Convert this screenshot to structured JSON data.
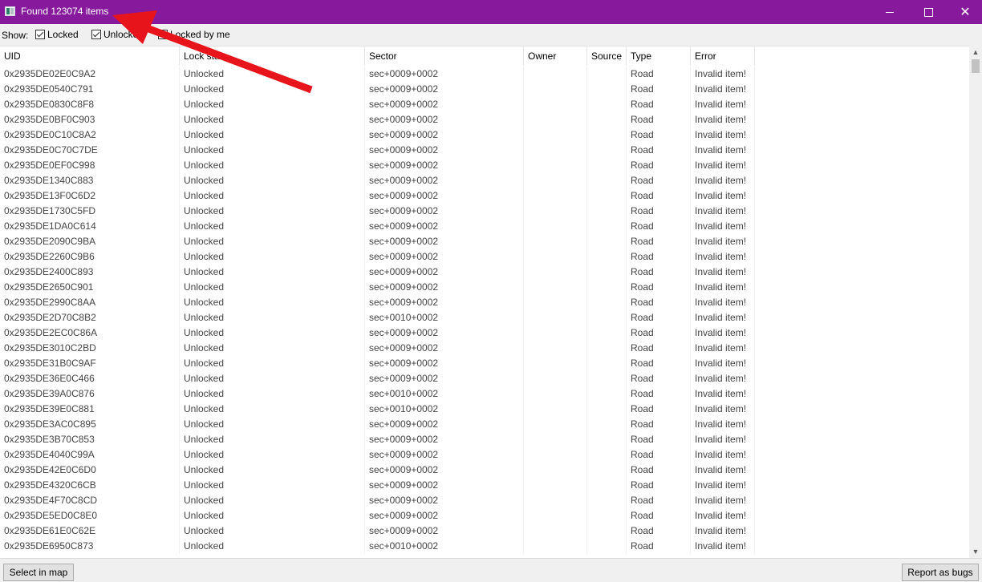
{
  "window": {
    "title": "Found 123074 items",
    "accent_color": "#871a9c",
    "controls": [
      "minimize",
      "maximize",
      "close"
    ]
  },
  "filter": {
    "show_label": "Show:",
    "options": [
      {
        "label": "Locked",
        "checked": true
      },
      {
        "label": "Unlocked",
        "checked": true
      },
      {
        "label": "Locked by me",
        "checked": false
      }
    ]
  },
  "table": {
    "columns": [
      "UID",
      "Lock state",
      "Sector",
      "Owner",
      "Source",
      "Type",
      "Error"
    ],
    "rows": [
      {
        "uid": "0x2935DE02E0C9A2",
        "lock": "Unlocked",
        "sector": "sec+0009+0002",
        "owner": "",
        "source": "",
        "type": "Road",
        "error": "Invalid item!"
      },
      {
        "uid": "0x2935DE0540C791",
        "lock": "Unlocked",
        "sector": "sec+0009+0002",
        "owner": "",
        "source": "",
        "type": "Road",
        "error": "Invalid item!"
      },
      {
        "uid": "0x2935DE0830C8F8",
        "lock": "Unlocked",
        "sector": "sec+0009+0002",
        "owner": "",
        "source": "",
        "type": "Road",
        "error": "Invalid item!"
      },
      {
        "uid": "0x2935DE0BF0C903",
        "lock": "Unlocked",
        "sector": "sec+0009+0002",
        "owner": "",
        "source": "",
        "type": "Road",
        "error": "Invalid item!"
      },
      {
        "uid": "0x2935DE0C10C8A2",
        "lock": "Unlocked",
        "sector": "sec+0009+0002",
        "owner": "",
        "source": "",
        "type": "Road",
        "error": "Invalid item!"
      },
      {
        "uid": "0x2935DE0C70C7DE",
        "lock": "Unlocked",
        "sector": "sec+0009+0002",
        "owner": "",
        "source": "",
        "type": "Road",
        "error": "Invalid item!"
      },
      {
        "uid": "0x2935DE0EF0C998",
        "lock": "Unlocked",
        "sector": "sec+0009+0002",
        "owner": "",
        "source": "",
        "type": "Road",
        "error": "Invalid item!"
      },
      {
        "uid": "0x2935DE1340C883",
        "lock": "Unlocked",
        "sector": "sec+0009+0002",
        "owner": "",
        "source": "",
        "type": "Road",
        "error": "Invalid item!"
      },
      {
        "uid": "0x2935DE13F0C6D2",
        "lock": "Unlocked",
        "sector": "sec+0009+0002",
        "owner": "",
        "source": "",
        "type": "Road",
        "error": "Invalid item!"
      },
      {
        "uid": "0x2935DE1730C5FD",
        "lock": "Unlocked",
        "sector": "sec+0009+0002",
        "owner": "",
        "source": "",
        "type": "Road",
        "error": "Invalid item!"
      },
      {
        "uid": "0x2935DE1DA0C614",
        "lock": "Unlocked",
        "sector": "sec+0009+0002",
        "owner": "",
        "source": "",
        "type": "Road",
        "error": "Invalid item!"
      },
      {
        "uid": "0x2935DE2090C9BA",
        "lock": "Unlocked",
        "sector": "sec+0009+0002",
        "owner": "",
        "source": "",
        "type": "Road",
        "error": "Invalid item!"
      },
      {
        "uid": "0x2935DE2260C9B6",
        "lock": "Unlocked",
        "sector": "sec+0009+0002",
        "owner": "",
        "source": "",
        "type": "Road",
        "error": "Invalid item!"
      },
      {
        "uid": "0x2935DE2400C893",
        "lock": "Unlocked",
        "sector": "sec+0009+0002",
        "owner": "",
        "source": "",
        "type": "Road",
        "error": "Invalid item!"
      },
      {
        "uid": "0x2935DE2650C901",
        "lock": "Unlocked",
        "sector": "sec+0009+0002",
        "owner": "",
        "source": "",
        "type": "Road",
        "error": "Invalid item!"
      },
      {
        "uid": "0x2935DE2990C8AA",
        "lock": "Unlocked",
        "sector": "sec+0009+0002",
        "owner": "",
        "source": "",
        "type": "Road",
        "error": "Invalid item!"
      },
      {
        "uid": "0x2935DE2D70C8B2",
        "lock": "Unlocked",
        "sector": "sec+0010+0002",
        "owner": "",
        "source": "",
        "type": "Road",
        "error": "Invalid item!"
      },
      {
        "uid": "0x2935DE2EC0C86A",
        "lock": "Unlocked",
        "sector": "sec+0009+0002",
        "owner": "",
        "source": "",
        "type": "Road",
        "error": "Invalid item!"
      },
      {
        "uid": "0x2935DE3010C2BD",
        "lock": "Unlocked",
        "sector": "sec+0009+0002",
        "owner": "",
        "source": "",
        "type": "Road",
        "error": "Invalid item!"
      },
      {
        "uid": "0x2935DE31B0C9AF",
        "lock": "Unlocked",
        "sector": "sec+0009+0002",
        "owner": "",
        "source": "",
        "type": "Road",
        "error": "Invalid item!"
      },
      {
        "uid": "0x2935DE36E0C466",
        "lock": "Unlocked",
        "sector": "sec+0009+0002",
        "owner": "",
        "source": "",
        "type": "Road",
        "error": "Invalid item!"
      },
      {
        "uid": "0x2935DE39A0C876",
        "lock": "Unlocked",
        "sector": "sec+0010+0002",
        "owner": "",
        "source": "",
        "type": "Road",
        "error": "Invalid item!"
      },
      {
        "uid": "0x2935DE39E0C881",
        "lock": "Unlocked",
        "sector": "sec+0010+0002",
        "owner": "",
        "source": "",
        "type": "Road",
        "error": "Invalid item!"
      },
      {
        "uid": "0x2935DE3AC0C895",
        "lock": "Unlocked",
        "sector": "sec+0009+0002",
        "owner": "",
        "source": "",
        "type": "Road",
        "error": "Invalid item!"
      },
      {
        "uid": "0x2935DE3B70C853",
        "lock": "Unlocked",
        "sector": "sec+0009+0002",
        "owner": "",
        "source": "",
        "type": "Road",
        "error": "Invalid item!"
      },
      {
        "uid": "0x2935DE4040C99A",
        "lock": "Unlocked",
        "sector": "sec+0009+0002",
        "owner": "",
        "source": "",
        "type": "Road",
        "error": "Invalid item!"
      },
      {
        "uid": "0x2935DE42E0C6D0",
        "lock": "Unlocked",
        "sector": "sec+0009+0002",
        "owner": "",
        "source": "",
        "type": "Road",
        "error": "Invalid item!"
      },
      {
        "uid": "0x2935DE4320C6CB",
        "lock": "Unlocked",
        "sector": "sec+0009+0002",
        "owner": "",
        "source": "",
        "type": "Road",
        "error": "Invalid item!"
      },
      {
        "uid": "0x2935DE4F70C8CD",
        "lock": "Unlocked",
        "sector": "sec+0009+0002",
        "owner": "",
        "source": "",
        "type": "Road",
        "error": "Invalid item!"
      },
      {
        "uid": "0x2935DE5ED0C8E0",
        "lock": "Unlocked",
        "sector": "sec+0009+0002",
        "owner": "",
        "source": "",
        "type": "Road",
        "error": "Invalid item!"
      },
      {
        "uid": "0x2935DE61E0C62E",
        "lock": "Unlocked",
        "sector": "sec+0009+0002",
        "owner": "",
        "source": "",
        "type": "Road",
        "error": "Invalid item!"
      },
      {
        "uid": "0x2935DE6950C873",
        "lock": "Unlocked",
        "sector": "sec+0010+0002",
        "owner": "",
        "source": "",
        "type": "Road",
        "error": "Invalid item!"
      }
    ]
  },
  "footer": {
    "select_label": "Select in map",
    "report_label": "Report as bugs"
  },
  "annotation": {
    "type": "red-arrow",
    "color": "#e8141b"
  }
}
